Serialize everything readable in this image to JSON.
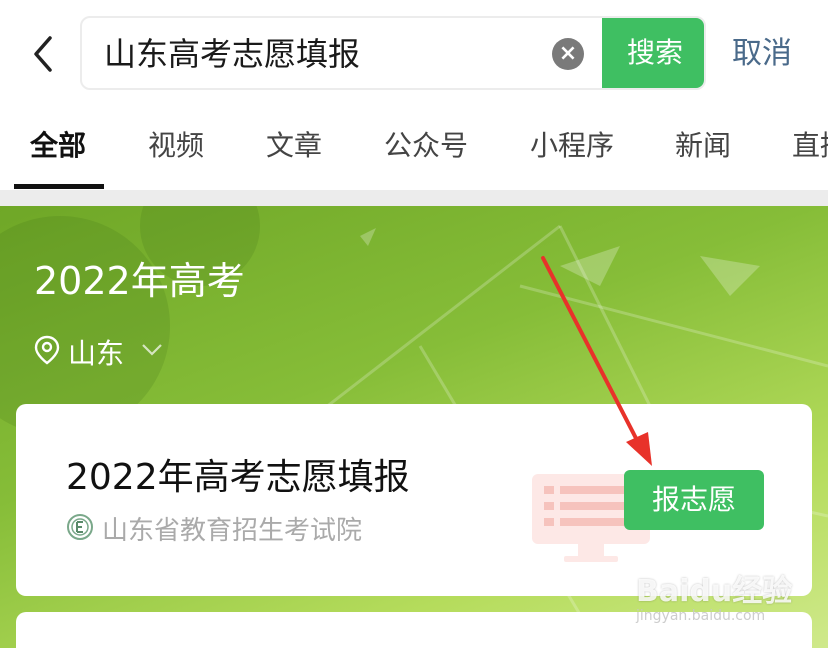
{
  "header": {
    "search_query": "山东高考志愿填报",
    "search_button": "搜索",
    "cancel_label": "取消"
  },
  "tabs": [
    {
      "label": "全部",
      "active": true
    },
    {
      "label": "视频"
    },
    {
      "label": "文章"
    },
    {
      "label": "公众号"
    },
    {
      "label": "小程序"
    },
    {
      "label": "新闻"
    },
    {
      "label": "直播"
    }
  ],
  "banner": {
    "title": "2022年高考",
    "location": "山东"
  },
  "card": {
    "title": "2022年高考志愿填报",
    "source": "山东省教育招生考试院",
    "action_label": "报志愿"
  },
  "watermark": {
    "brand": "Baidu经验",
    "url": "jingyan.baidu.com"
  },
  "colors": {
    "accent_green": "#3fbf62",
    "banner_green": "#86bd38",
    "annotation_red": "#e8322a"
  }
}
